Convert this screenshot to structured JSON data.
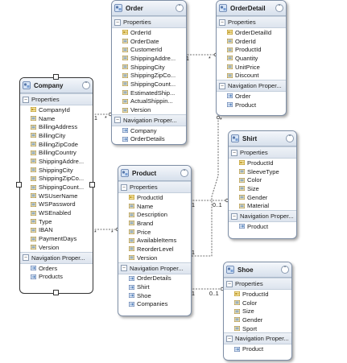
{
  "entities": {
    "order": {
      "title": "Order",
      "properties_label": "Properties",
      "properties": [
        {
          "name": "OrderId",
          "key": true
        },
        {
          "name": "OrderDate"
        },
        {
          "name": "CustomerId"
        },
        {
          "name": "ShippingAddre..."
        },
        {
          "name": "ShippingCity"
        },
        {
          "name": "ShippingZipCo..."
        },
        {
          "name": "ShippingCount..."
        },
        {
          "name": "EstimatedShip..."
        },
        {
          "name": "ActualShippin..."
        },
        {
          "name": "Version"
        }
      ],
      "nav_label": "Navigation Proper...",
      "nav": [
        "Company",
        "OrderDetails"
      ]
    },
    "orderdetail": {
      "title": "OrderDetail",
      "properties_label": "Properties",
      "properties": [
        {
          "name": "OrderDetailId",
          "key": true
        },
        {
          "name": "OrderId"
        },
        {
          "name": "ProductId"
        },
        {
          "name": "Quantity"
        },
        {
          "name": "UnitPrice"
        },
        {
          "name": "Discount"
        }
      ],
      "nav_label": "Navigation Proper...",
      "nav": [
        "Order",
        "Product"
      ]
    },
    "company": {
      "title": "Company",
      "properties_label": "Properties",
      "properties": [
        {
          "name": "CompanyId",
          "key": true
        },
        {
          "name": "Name"
        },
        {
          "name": "BillingAddress"
        },
        {
          "name": "BillingCity"
        },
        {
          "name": "BillingZipCode"
        },
        {
          "name": "BillingCountry"
        },
        {
          "name": "ShippingAddre..."
        },
        {
          "name": "ShippingCity"
        },
        {
          "name": "ShippingZipCo..."
        },
        {
          "name": "ShippingCount..."
        },
        {
          "name": "WSUserName"
        },
        {
          "name": "WSPassword"
        },
        {
          "name": "WSEnabled"
        },
        {
          "name": "Type"
        },
        {
          "name": "IBAN"
        },
        {
          "name": "PaymentDays"
        },
        {
          "name": "Version"
        }
      ],
      "nav_label": "Navigation Proper...",
      "nav": [
        "Orders",
        "Products"
      ]
    },
    "shirt": {
      "title": "Shirt",
      "properties_label": "Properties",
      "properties": [
        {
          "name": "ProductId",
          "key": true
        },
        {
          "name": "SleeveType"
        },
        {
          "name": "Color"
        },
        {
          "name": "Size"
        },
        {
          "name": "Gender"
        },
        {
          "name": "Material"
        }
      ],
      "nav_label": "Navigation Proper...",
      "nav": [
        "Product"
      ]
    },
    "product": {
      "title": "Product",
      "properties_label": "Properties",
      "properties": [
        {
          "name": "ProductId",
          "key": true
        },
        {
          "name": "Name"
        },
        {
          "name": "Description"
        },
        {
          "name": "Brand"
        },
        {
          "name": "Price"
        },
        {
          "name": "AvailableItems"
        },
        {
          "name": "ReorderLevel"
        },
        {
          "name": "Version"
        }
      ],
      "nav_label": "Navigation Proper...",
      "nav": [
        "OrderDetails",
        "Shirt",
        "Shoe",
        "Companies"
      ]
    },
    "shoe": {
      "title": "Shoe",
      "properties_label": "Properties",
      "properties": [
        {
          "name": "ProductId",
          "key": true
        },
        {
          "name": "Color"
        },
        {
          "name": "Size"
        },
        {
          "name": "Gender"
        },
        {
          "name": "Sport"
        }
      ],
      "nav_label": "Navigation Proper...",
      "nav": [
        "Product"
      ]
    }
  },
  "multiplicities": {
    "order_od_1": "1",
    "order_od_many": "*",
    "company_order_1": "1",
    "company_order_many": "*",
    "od_product_many": "*",
    "company_product_many_a": "*",
    "company_product_many_b": "*",
    "product_shirt_1": "1",
    "product_shirt_01": "0..1",
    "product_od_1": "1",
    "product_shoe_1": "1",
    "product_shoe_01": "0..1"
  },
  "colors": {
    "header_top": "#f4f7fb",
    "header_bottom": "#d7e0ec",
    "border": "#7f8fa6",
    "key_icon": "#d6a21c",
    "prop_icon": "#3a6fb0"
  }
}
